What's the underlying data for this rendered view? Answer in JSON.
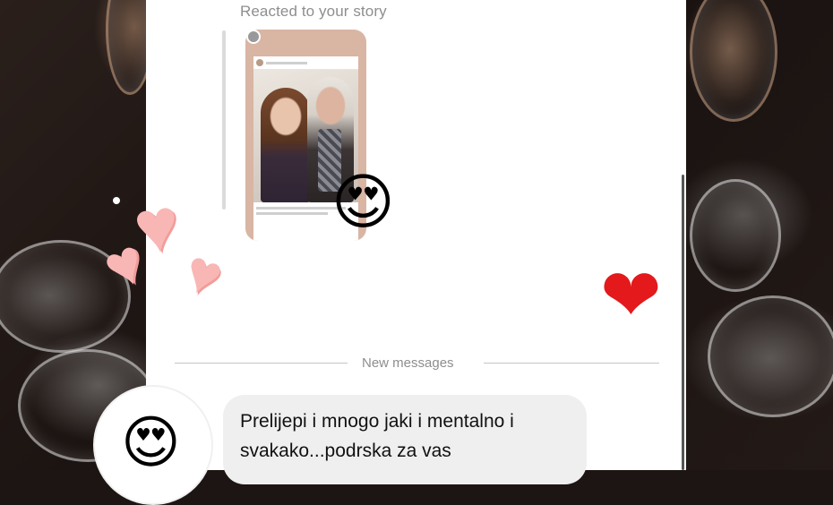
{
  "story": {
    "label": "Reacted to your story",
    "reaction_icon": "heart-eyes-emoji",
    "reaction_glyph": "😍"
  },
  "decorations": {
    "red_heart_glyph": "❤",
    "pink_heart_glyph": "♥"
  },
  "divider": {
    "label": "New messages"
  },
  "message": {
    "avatar_icon": "heart-eyes-emoji",
    "avatar_glyph": "😍",
    "text": "Prelijepi i mnogo jaki i mentalno i\nsvakako...podrska za vas"
  },
  "colors": {
    "panel_bg": "#ffffff",
    "bubble_bg": "#efefef",
    "muted_text": "#8e8e8e",
    "red_heart": "#e3191c",
    "pink_heart": "#f8b7b5"
  }
}
